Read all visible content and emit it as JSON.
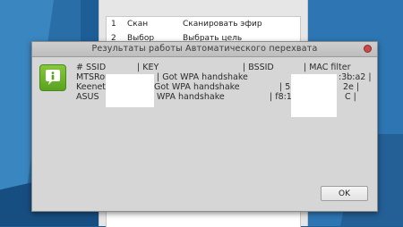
{
  "background_window": {
    "menu_rows": [
      {
        "num": "1",
        "command": "Скан",
        "description": "Сканировать эфир"
      },
      {
        "num": "2",
        "command": "Выбор",
        "description": "Выбрать цель"
      }
    ]
  },
  "dialog": {
    "title": "Результаты работы Автоматического перехвата",
    "header": {
      "ssid": "# SSID",
      "key": "| KEY",
      "bssid": "| BSSID",
      "mac": "| MAC filter"
    },
    "rows": [
      {
        "ssid": "MTSRou",
        "key": "| Got WPA handshake",
        "bssid_tail": "",
        "mac_tail": ":3b:a2 |"
      },
      {
        "ssid": "Keenetic",
        "key": "Got WPA handshake",
        "bssid_tail": "| 5",
        "mac_tail": "2e |"
      },
      {
        "ssid": "ASUS",
        "key": "WPA handshake",
        "bssid_tail": "| f8:1a",
        "mac_tail": "C |"
      }
    ],
    "ok_label": "OK"
  },
  "icons": {
    "info": "info-icon",
    "close": "close-icon"
  },
  "colors": {
    "desktop": "#1d5e97",
    "icon_green": "#6cb52c",
    "close_red": "#c94a4a"
  }
}
